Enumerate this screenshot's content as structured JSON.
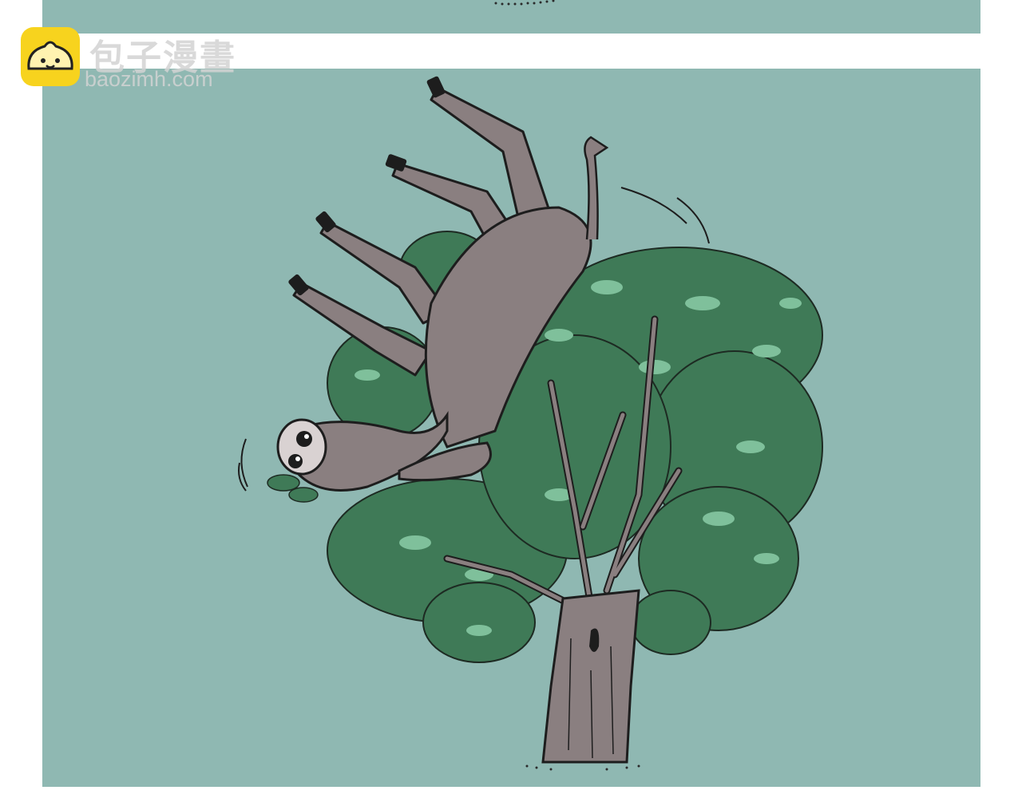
{
  "watermark": {
    "title": "包子漫畫",
    "url": "baozimh.com",
    "icon": "bun-mascot-icon"
  },
  "illustration": {
    "icons": [
      "donkey-icon",
      "tree-icon"
    ]
  },
  "colors": {
    "panel_bg": "#8fb8b2",
    "donkey": "#8a7f80",
    "foliage": "#3f7a57",
    "foliage_light": "#7fc09b",
    "trunk": "#8a7f80",
    "badge": "#f7d31e"
  }
}
